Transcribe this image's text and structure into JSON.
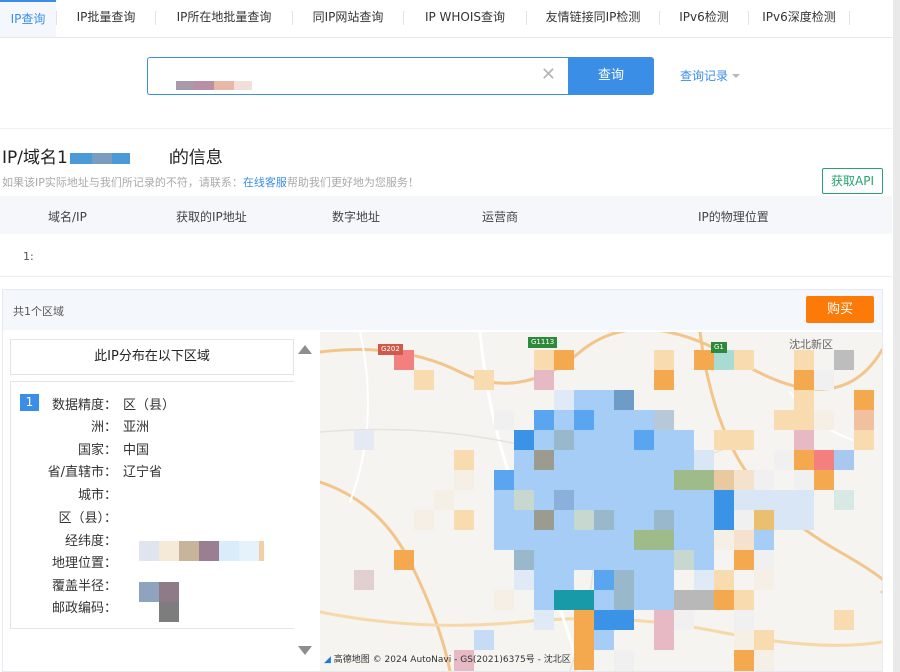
{
  "tabs": [
    {
      "label": "IP查询",
      "active": true
    },
    {
      "label": "IP批量查询"
    },
    {
      "label": "IP所在地批量查询"
    },
    {
      "label": "同IP网站查询"
    },
    {
      "label": "IP WHOIS查询"
    },
    {
      "label": "友情链接同IP检测"
    },
    {
      "label": "IPv6检测"
    },
    {
      "label": "IPv6深度检测"
    }
  ],
  "search": {
    "button_label": "查询",
    "clear_icon": "close-icon",
    "history_label": "查询记录"
  },
  "info": {
    "title_prefix": "IP/域名1",
    "title_suffix": "的信息",
    "notice_before": "如果该IP实际地址与我们所记录的不符，请联系：",
    "notice_link": "在线客服",
    "notice_after": "帮助我们更好地为您服务！",
    "api_button": "获取API"
  },
  "table": {
    "headers": [
      "域名/IP",
      "获取的IP地址",
      "数字地址",
      "运营商",
      "IP的物理位置"
    ],
    "first_cell": "1:"
  },
  "region": {
    "count_label": "共1个区域",
    "buy_button": "购买",
    "dist_title": "此IP分布在以下区域",
    "index": "1",
    "fields": [
      {
        "key": "数据精度：",
        "value": "区（县）"
      },
      {
        "key": "洲：",
        "value": "亚洲"
      },
      {
        "key": "国家：",
        "value": "中国"
      },
      {
        "key": "省/直辖市：",
        "value": "辽宁省"
      },
      {
        "key": "城市：",
        "value": ""
      },
      {
        "key": "区（县）：",
        "value": ""
      },
      {
        "key": "经纬度：",
        "value": ""
      },
      {
        "key": "地理位置：",
        "value": ""
      },
      {
        "key": "覆盖半径：",
        "value": ""
      },
      {
        "key": "邮政编码：",
        "value": ""
      }
    ]
  },
  "map": {
    "labels": [
      "沈北新区"
    ],
    "road_shields": [
      "G1113",
      "G1",
      "G202"
    ],
    "credit": "高德地图  © 2024 AutoNavi - GS(2021)6375号 - 沈北区"
  },
  "colors": {
    "accent": "#3a8ee6",
    "buy": "#fb7a08",
    "api": "#25a36f"
  }
}
